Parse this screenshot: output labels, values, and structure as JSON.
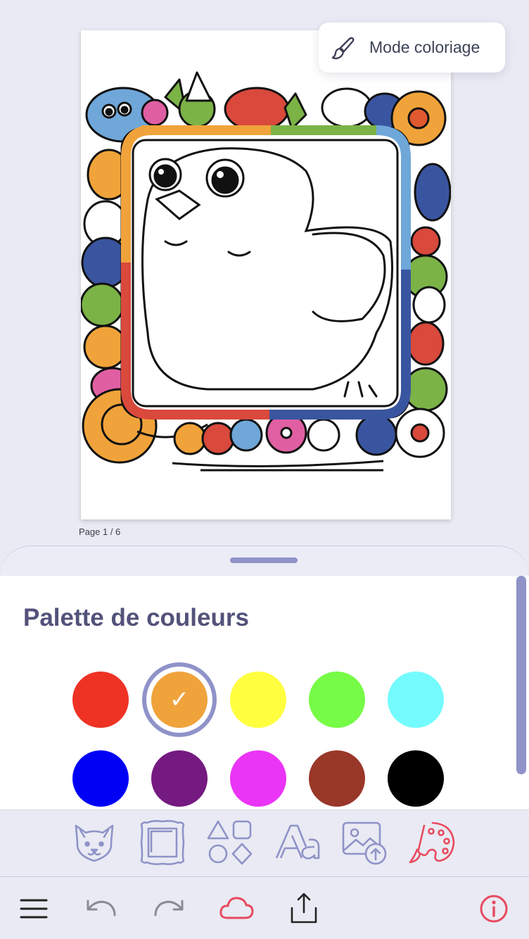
{
  "mode_button": {
    "label": "Mode coloriage",
    "icon": "brush-icon"
  },
  "page_indicator": "Page 1 / 6",
  "palette": {
    "title": "Palette de couleurs",
    "selected_index": 1,
    "colors": [
      "#ee3325",
      "#f0a33a",
      "#ffff40",
      "#76fb46",
      "#74fbfd",
      "#0000f5",
      "#751a80",
      "#ea34f6",
      "#993729",
      "#000000"
    ]
  },
  "tools": [
    {
      "name": "animals-tool",
      "icon": "fox-face-icon"
    },
    {
      "name": "frames-tool",
      "icon": "frame-icon"
    },
    {
      "name": "shapes-tool",
      "icon": "shapes-icon"
    },
    {
      "name": "text-tool",
      "icon": "text-aa-icon"
    },
    {
      "name": "image-upload-tool",
      "icon": "image-upload-icon"
    },
    {
      "name": "color-palette-tool",
      "icon": "palette-icon",
      "active": true
    }
  ],
  "nav": [
    {
      "name": "menu",
      "icon": "hamburger-icon"
    },
    {
      "name": "undo",
      "icon": "undo-icon"
    },
    {
      "name": "redo",
      "icon": "redo-icon"
    },
    {
      "name": "cloud-save",
      "icon": "cloud-icon"
    },
    {
      "name": "share",
      "icon": "share-icon"
    },
    {
      "name": "info",
      "icon": "info-icon"
    }
  ],
  "colors": {
    "accent": "#8f93c8",
    "active_red": "#e84a5f",
    "title": "#52527a"
  }
}
